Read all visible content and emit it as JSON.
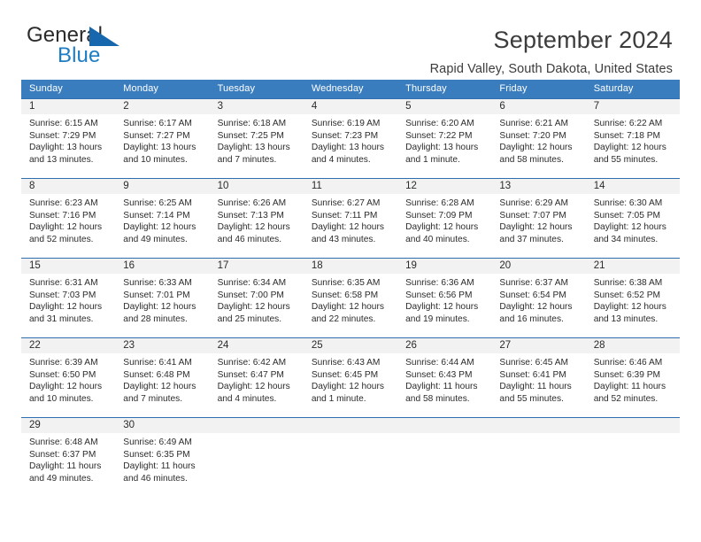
{
  "brand": {
    "word1": "General",
    "word2": "Blue",
    "triangle_color": "#1667ae",
    "blue_color": "#1c7cc4"
  },
  "header": {
    "title": "September 2024",
    "subtitle": "Rapid Valley, South Dakota, United States"
  },
  "theme": {
    "header_bg": "#3a7dbf",
    "week_rule": "#2f6fb0",
    "daynum_bg": "#f2f2f2",
    "text": "#2b2b2b"
  },
  "calendar": {
    "weekday_headers": [
      "Sunday",
      "Monday",
      "Tuesday",
      "Wednesday",
      "Thursday",
      "Friday",
      "Saturday"
    ],
    "labels": {
      "sunrise": "Sunrise:",
      "sunset": "Sunset:",
      "daylight": "Daylight:"
    },
    "weeks": [
      {
        "days": [
          {
            "num": "1",
            "sunrise": "Sunrise: 6:15 AM",
            "sunset": "Sunset: 7:29 PM",
            "daylight1": "Daylight: 13 hours",
            "daylight2": "and 13 minutes."
          },
          {
            "num": "2",
            "sunrise": "Sunrise: 6:17 AM",
            "sunset": "Sunset: 7:27 PM",
            "daylight1": "Daylight: 13 hours",
            "daylight2": "and 10 minutes."
          },
          {
            "num": "3",
            "sunrise": "Sunrise: 6:18 AM",
            "sunset": "Sunset: 7:25 PM",
            "daylight1": "Daylight: 13 hours",
            "daylight2": "and 7 minutes."
          },
          {
            "num": "4",
            "sunrise": "Sunrise: 6:19 AM",
            "sunset": "Sunset: 7:23 PM",
            "daylight1": "Daylight: 13 hours",
            "daylight2": "and 4 minutes."
          },
          {
            "num": "5",
            "sunrise": "Sunrise: 6:20 AM",
            "sunset": "Sunset: 7:22 PM",
            "daylight1": "Daylight: 13 hours",
            "daylight2": "and 1 minute."
          },
          {
            "num": "6",
            "sunrise": "Sunrise: 6:21 AM",
            "sunset": "Sunset: 7:20 PM",
            "daylight1": "Daylight: 12 hours",
            "daylight2": "and 58 minutes."
          },
          {
            "num": "7",
            "sunrise": "Sunrise: 6:22 AM",
            "sunset": "Sunset: 7:18 PM",
            "daylight1": "Daylight: 12 hours",
            "daylight2": "and 55 minutes."
          }
        ]
      },
      {
        "days": [
          {
            "num": "8",
            "sunrise": "Sunrise: 6:23 AM",
            "sunset": "Sunset: 7:16 PM",
            "daylight1": "Daylight: 12 hours",
            "daylight2": "and 52 minutes."
          },
          {
            "num": "9",
            "sunrise": "Sunrise: 6:25 AM",
            "sunset": "Sunset: 7:14 PM",
            "daylight1": "Daylight: 12 hours",
            "daylight2": "and 49 minutes."
          },
          {
            "num": "10",
            "sunrise": "Sunrise: 6:26 AM",
            "sunset": "Sunset: 7:13 PM",
            "daylight1": "Daylight: 12 hours",
            "daylight2": "and 46 minutes."
          },
          {
            "num": "11",
            "sunrise": "Sunrise: 6:27 AM",
            "sunset": "Sunset: 7:11 PM",
            "daylight1": "Daylight: 12 hours",
            "daylight2": "and 43 minutes."
          },
          {
            "num": "12",
            "sunrise": "Sunrise: 6:28 AM",
            "sunset": "Sunset: 7:09 PM",
            "daylight1": "Daylight: 12 hours",
            "daylight2": "and 40 minutes."
          },
          {
            "num": "13",
            "sunrise": "Sunrise: 6:29 AM",
            "sunset": "Sunset: 7:07 PM",
            "daylight1": "Daylight: 12 hours",
            "daylight2": "and 37 minutes."
          },
          {
            "num": "14",
            "sunrise": "Sunrise: 6:30 AM",
            "sunset": "Sunset: 7:05 PM",
            "daylight1": "Daylight: 12 hours",
            "daylight2": "and 34 minutes."
          }
        ]
      },
      {
        "days": [
          {
            "num": "15",
            "sunrise": "Sunrise: 6:31 AM",
            "sunset": "Sunset: 7:03 PM",
            "daylight1": "Daylight: 12 hours",
            "daylight2": "and 31 minutes."
          },
          {
            "num": "16",
            "sunrise": "Sunrise: 6:33 AM",
            "sunset": "Sunset: 7:01 PM",
            "daylight1": "Daylight: 12 hours",
            "daylight2": "and 28 minutes."
          },
          {
            "num": "17",
            "sunrise": "Sunrise: 6:34 AM",
            "sunset": "Sunset: 7:00 PM",
            "daylight1": "Daylight: 12 hours",
            "daylight2": "and 25 minutes."
          },
          {
            "num": "18",
            "sunrise": "Sunrise: 6:35 AM",
            "sunset": "Sunset: 6:58 PM",
            "daylight1": "Daylight: 12 hours",
            "daylight2": "and 22 minutes."
          },
          {
            "num": "19",
            "sunrise": "Sunrise: 6:36 AM",
            "sunset": "Sunset: 6:56 PM",
            "daylight1": "Daylight: 12 hours",
            "daylight2": "and 19 minutes."
          },
          {
            "num": "20",
            "sunrise": "Sunrise: 6:37 AM",
            "sunset": "Sunset: 6:54 PM",
            "daylight1": "Daylight: 12 hours",
            "daylight2": "and 16 minutes."
          },
          {
            "num": "21",
            "sunrise": "Sunrise: 6:38 AM",
            "sunset": "Sunset: 6:52 PM",
            "daylight1": "Daylight: 12 hours",
            "daylight2": "and 13 minutes."
          }
        ]
      },
      {
        "days": [
          {
            "num": "22",
            "sunrise": "Sunrise: 6:39 AM",
            "sunset": "Sunset: 6:50 PM",
            "daylight1": "Daylight: 12 hours",
            "daylight2": "and 10 minutes."
          },
          {
            "num": "23",
            "sunrise": "Sunrise: 6:41 AM",
            "sunset": "Sunset: 6:48 PM",
            "daylight1": "Daylight: 12 hours",
            "daylight2": "and 7 minutes."
          },
          {
            "num": "24",
            "sunrise": "Sunrise: 6:42 AM",
            "sunset": "Sunset: 6:47 PM",
            "daylight1": "Daylight: 12 hours",
            "daylight2": "and 4 minutes."
          },
          {
            "num": "25",
            "sunrise": "Sunrise: 6:43 AM",
            "sunset": "Sunset: 6:45 PM",
            "daylight1": "Daylight: 12 hours",
            "daylight2": "and 1 minute."
          },
          {
            "num": "26",
            "sunrise": "Sunrise: 6:44 AM",
            "sunset": "Sunset: 6:43 PM",
            "daylight1": "Daylight: 11 hours",
            "daylight2": "and 58 minutes."
          },
          {
            "num": "27",
            "sunrise": "Sunrise: 6:45 AM",
            "sunset": "Sunset: 6:41 PM",
            "daylight1": "Daylight: 11 hours",
            "daylight2": "and 55 minutes."
          },
          {
            "num": "28",
            "sunrise": "Sunrise: 6:46 AM",
            "sunset": "Sunset: 6:39 PM",
            "daylight1": "Daylight: 11 hours",
            "daylight2": "and 52 minutes."
          }
        ]
      },
      {
        "days": [
          {
            "num": "29",
            "sunrise": "Sunrise: 6:48 AM",
            "sunset": "Sunset: 6:37 PM",
            "daylight1": "Daylight: 11 hours",
            "daylight2": "and 49 minutes."
          },
          {
            "num": "30",
            "sunrise": "Sunrise: 6:49 AM",
            "sunset": "Sunset: 6:35 PM",
            "daylight1": "Daylight: 11 hours",
            "daylight2": "and 46 minutes."
          },
          {
            "num": "",
            "sunrise": "",
            "sunset": "",
            "daylight1": "",
            "daylight2": ""
          },
          {
            "num": "",
            "sunrise": "",
            "sunset": "",
            "daylight1": "",
            "daylight2": ""
          },
          {
            "num": "",
            "sunrise": "",
            "sunset": "",
            "daylight1": "",
            "daylight2": ""
          },
          {
            "num": "",
            "sunrise": "",
            "sunset": "",
            "daylight1": "",
            "daylight2": ""
          },
          {
            "num": "",
            "sunrise": "",
            "sunset": "",
            "daylight1": "",
            "daylight2": ""
          }
        ]
      }
    ]
  }
}
